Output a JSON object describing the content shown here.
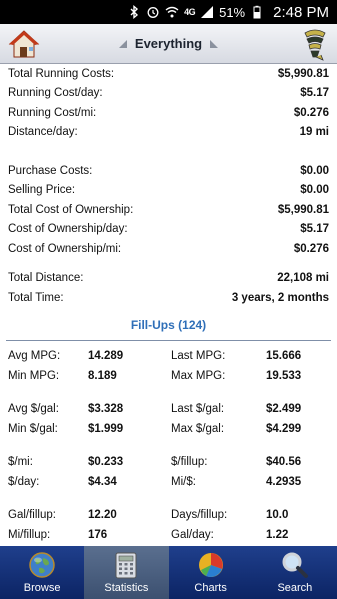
{
  "statusbar": {
    "network": "4G",
    "battery": "51%",
    "time": "2:48 PM"
  },
  "header": {
    "title": "Everything"
  },
  "summary": [
    {
      "label": "Total Running Costs:",
      "value": "$5,990.81"
    },
    {
      "label": "Running Cost/day:",
      "value": "$5.17"
    },
    {
      "label": "Running Cost/mi:",
      "value": "$0.276"
    },
    {
      "label": "Distance/day:",
      "value": "19 mi"
    }
  ],
  "ownership": [
    {
      "label": "Purchase Costs:",
      "value": "$0.00"
    },
    {
      "label": "Selling Price:",
      "value": "$0.00"
    },
    {
      "label": "Total Cost of Ownership:",
      "value": "$5,990.81"
    },
    {
      "label": "Cost of Ownership/day:",
      "value": "$5.17"
    },
    {
      "label": "Cost of Ownership/mi:",
      "value": "$0.276"
    }
  ],
  "totals": [
    {
      "label": "Total Distance:",
      "value": "22,108 mi"
    },
    {
      "label": "Total Time:",
      "value": "3 years, 2 months"
    }
  ],
  "fillups": {
    "title": "Fill-Ups (124)",
    "groups": [
      [
        {
          "l1": "Avg MPG:",
          "v1": "14.289",
          "l2": "Last MPG:",
          "v2": "15.666"
        },
        {
          "l1": "Min MPG:",
          "v1": "8.189",
          "l2": "Max MPG:",
          "v2": "19.533"
        }
      ],
      [
        {
          "l1": "Avg $/gal:",
          "v1": "$3.328",
          "l2": "Last $/gal:",
          "v2": "$2.499"
        },
        {
          "l1": "Min $/gal:",
          "v1": "$1.999",
          "l2": "Max $/gal:",
          "v2": "$4.299"
        }
      ],
      [
        {
          "l1": "$/mi:",
          "v1": "$0.233",
          "l2": "$/fillup:",
          "v2": "$40.56"
        },
        {
          "l1": "$/day:",
          "v1": "$4.34",
          "l2": "Mi/$:",
          "v2": "4.2935"
        }
      ],
      [
        {
          "l1": "Gal/fillup:",
          "v1": "12.20",
          "l2": "Days/fillup:",
          "v2": "10.0"
        },
        {
          "l1": "Mi/fillup:",
          "v1": "176",
          "l2": "Gal/day:",
          "v2": "1.22"
        }
      ]
    ]
  },
  "nav": {
    "tabs": [
      {
        "label": "Browse",
        "icon": "globe-icon"
      },
      {
        "label": "Statistics",
        "icon": "calculator-icon",
        "active": true
      },
      {
        "label": "Charts",
        "icon": "pie-chart-icon"
      },
      {
        "label": "Search",
        "icon": "magnifier-icon"
      }
    ]
  },
  "colors": {
    "accent": "#2f6fb8",
    "nav_bg": "#0c2464",
    "nav_active": "#4a5f80"
  }
}
